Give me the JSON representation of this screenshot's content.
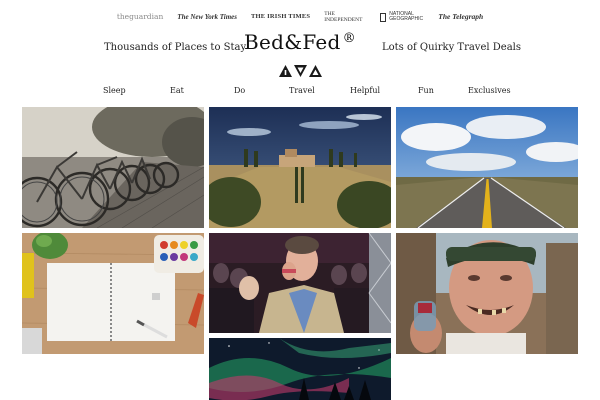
{
  "press": {
    "guardian": "theguardian",
    "nyt": "The New York Times",
    "irish_times": "THE IRISH TIMES",
    "independent": "THE INDEPENDENT",
    "natgeo": "NATIONAL GEOGRAPHIC",
    "telegraph": "The Telegraph"
  },
  "header": {
    "tagline_left": "Thousands of Places to Stay",
    "logo": "Bed&Fed",
    "logo_mark": "®",
    "tagline_right": "Lots of Quirky Travel Deals"
  },
  "nav": [
    "Sleep",
    "Eat",
    "Do",
    "Travel",
    "Helpful",
    "Fun",
    "Exclusives"
  ],
  "tiles": {
    "bikes": "bicycles-photo",
    "villa": "villa-photo",
    "road": "road-photo",
    "notebook": "notebook-photo",
    "presenter": "presenter-photo",
    "old_man": "old-man-photo",
    "aurora": "aurora-photo"
  }
}
